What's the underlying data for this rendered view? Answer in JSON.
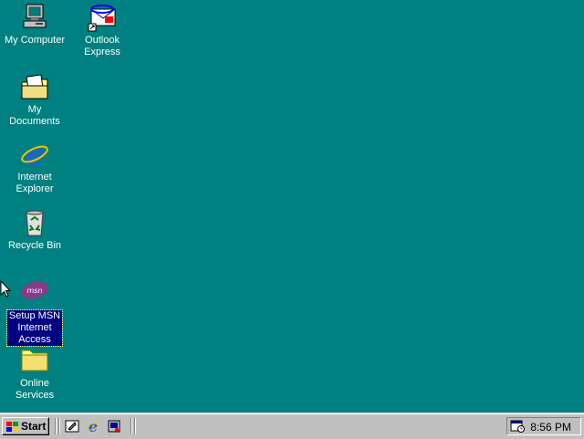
{
  "desktop": {
    "background_color": "#008080",
    "icons": [
      {
        "label": "My Computer",
        "icon": "my-computer-icon"
      },
      {
        "label": "Outlook\nExpress",
        "icon": "outlook-express-icon"
      },
      {
        "label": "My Documents",
        "icon": "my-documents-icon"
      },
      {
        "label": "Internet\nExplorer",
        "icon": "internet-explorer-icon"
      },
      {
        "label": "Recycle Bin",
        "icon": "recycle-bin-icon"
      },
      {
        "label": "Setup MSN\nInternet\nAccess",
        "icon": "msn-icon",
        "selected": true
      },
      {
        "label": "Online\nServices",
        "icon": "folder-icon"
      }
    ]
  },
  "taskbar": {
    "start_label": "Start",
    "quick_launch": [
      "show-desktop-icon",
      "internet-explorer-icon",
      "channels-icon"
    ],
    "tray": {
      "icon": "scheduler-icon",
      "clock": "8:56 PM"
    }
  }
}
